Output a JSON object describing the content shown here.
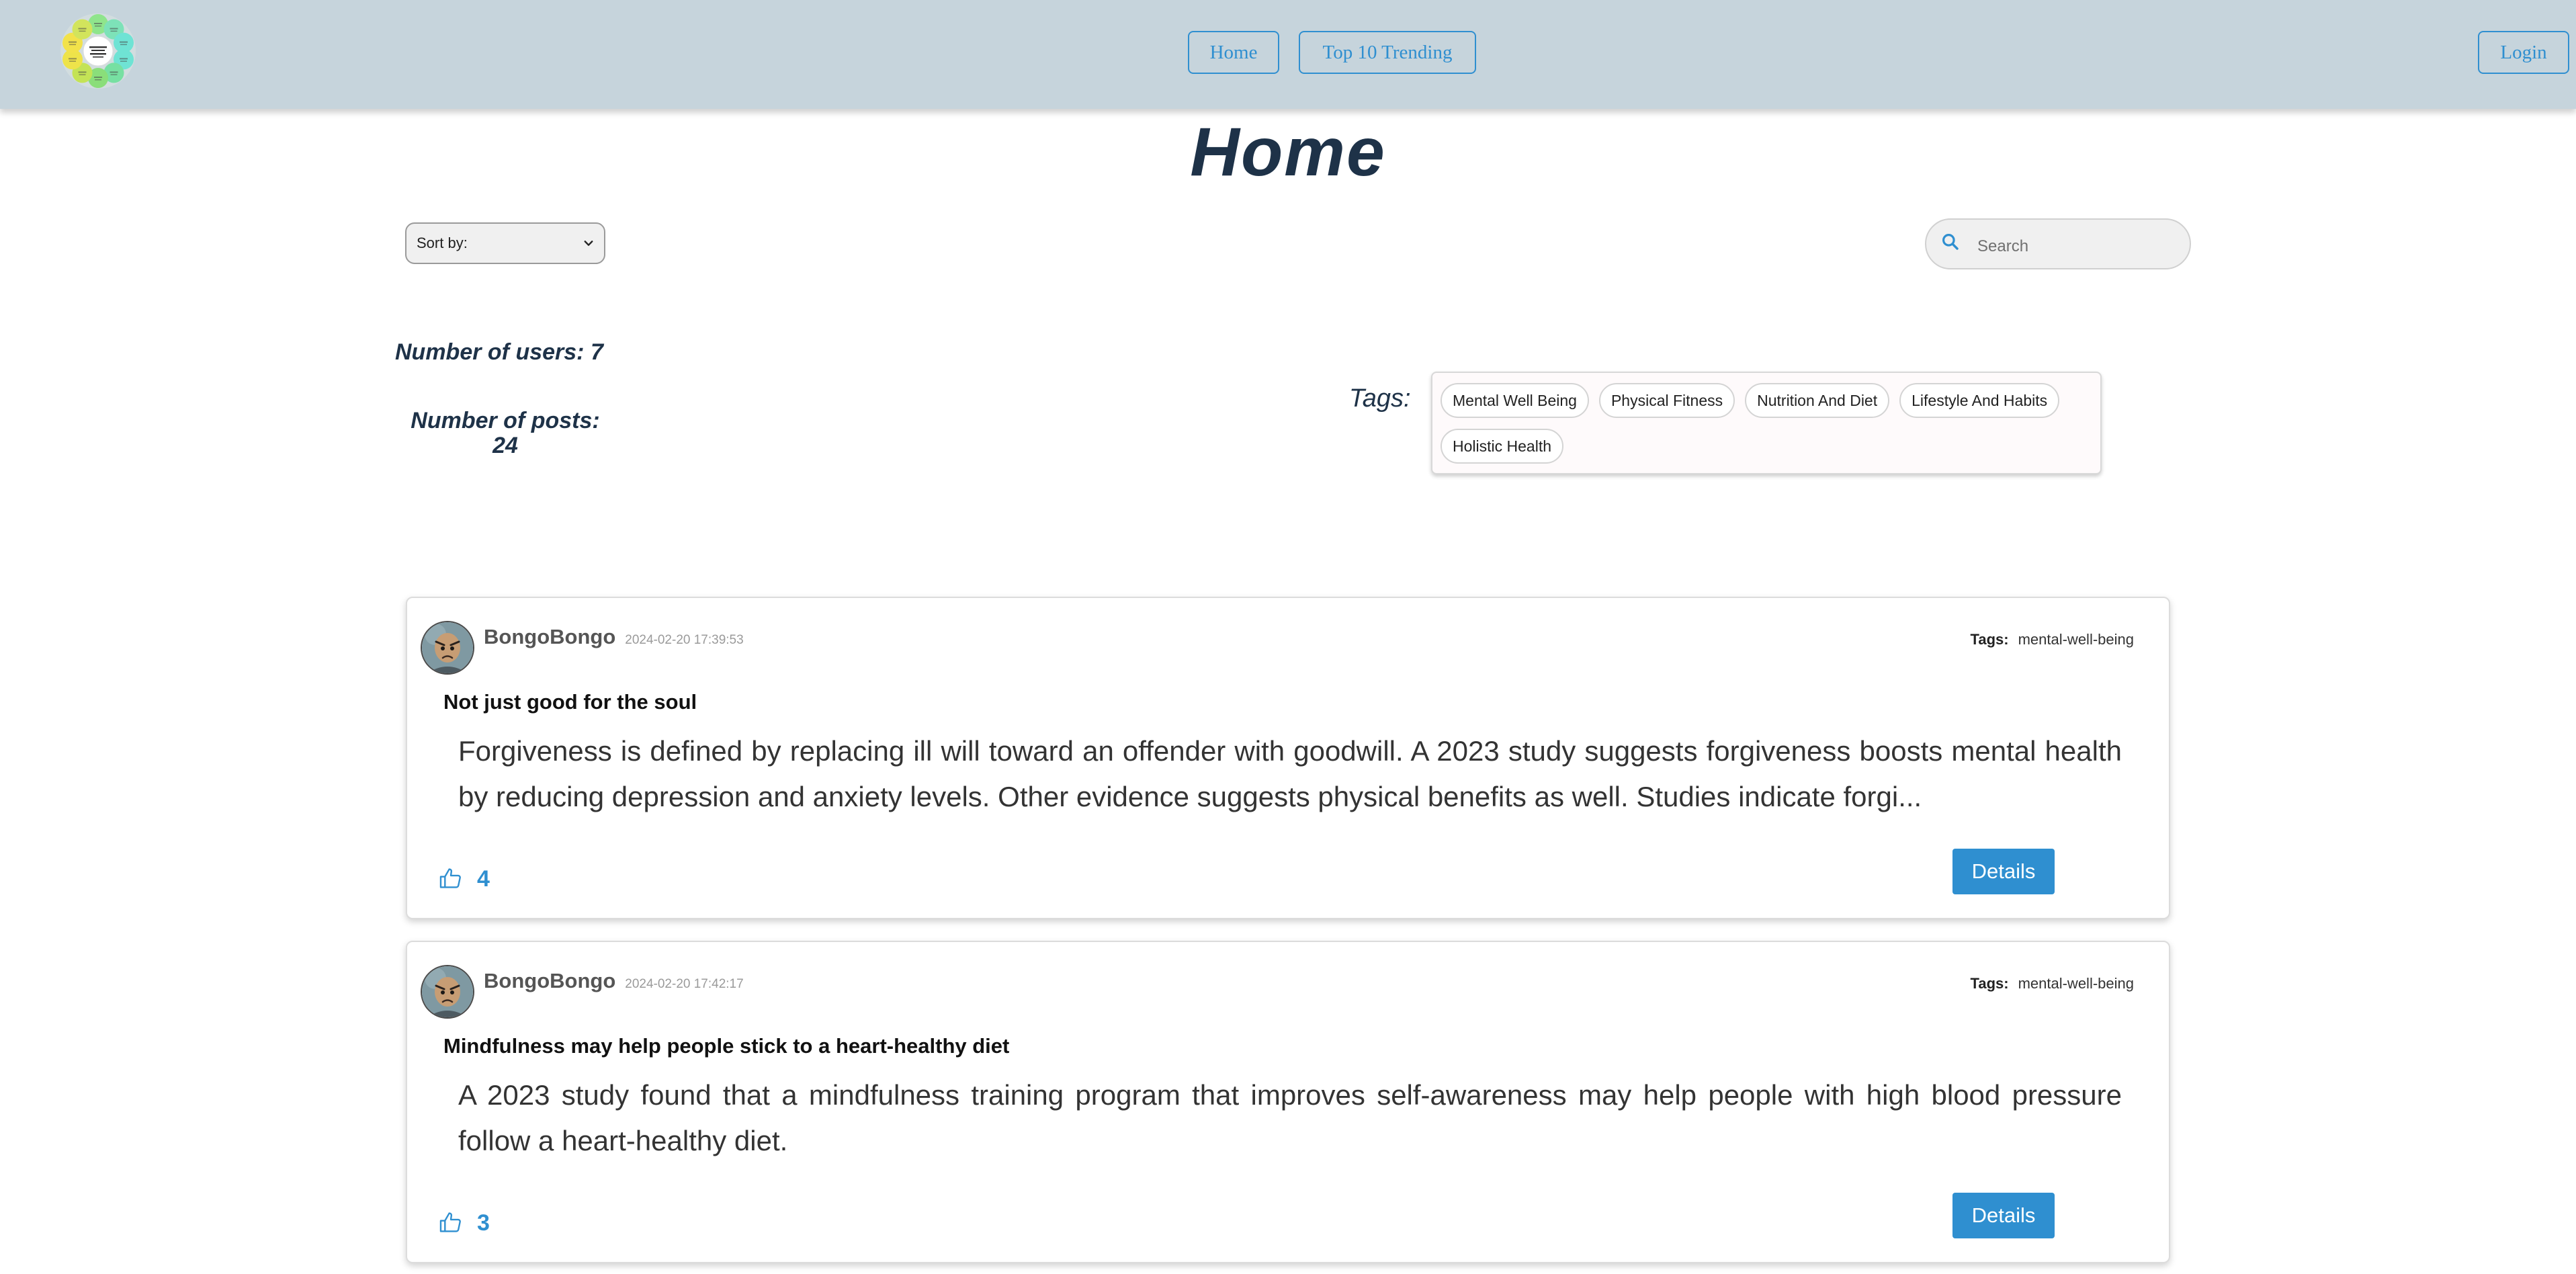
{
  "colors": {
    "accent": "#2f8fd0",
    "navbar_bg": "#c6d4dc",
    "heading": "#1e3248"
  },
  "icons": {
    "logo": "wellness-wheel-logo",
    "sort": "chevron-down-icon",
    "search": "search-icon",
    "like": "thumbs-up-icon"
  },
  "nav": {
    "home_label": "Home",
    "trending_label": "Top 10 Trending",
    "login_label": "Login"
  },
  "page": {
    "title": "Home"
  },
  "controls": {
    "sort_label": "Sort by:",
    "search_placeholder": "Search"
  },
  "stats": {
    "users_label": "Number of users:",
    "users_count": "7",
    "posts_label": "Number of posts:",
    "posts_count": "24"
  },
  "tags": {
    "label": "Tags:",
    "items": [
      "Mental Well Being",
      "Physical Fitness",
      "Nutrition And Diet",
      "Lifestyle And Habits",
      "Holistic Health"
    ]
  },
  "posts": [
    {
      "author": "BongoBongo",
      "timestamp": "2024-02-20 17:39:53",
      "tags_label": "Tags:",
      "tag": "mental-well-being",
      "title": "Not just good for the soul",
      "excerpt": "Forgiveness is defined by replacing ill will toward an offender with goodwill. A 2023 study suggests forgiveness boosts mental health by reducing depression and anxiety levels. Other evidence suggests physical benefits as well. Studies indicate forgi...",
      "likes": "4",
      "details_label": "Details"
    },
    {
      "author": "BongoBongo",
      "timestamp": "2024-02-20 17:42:17",
      "tags_label": "Tags:",
      "tag": "mental-well-being",
      "title": "Mindfulness may help people stick to a heart-healthy diet",
      "excerpt": "A 2023 study found that a mindfulness training program that improves self-awareness may help people with high blood pressure follow a heart-healthy diet.",
      "likes": "3",
      "details_label": "Details"
    }
  ]
}
